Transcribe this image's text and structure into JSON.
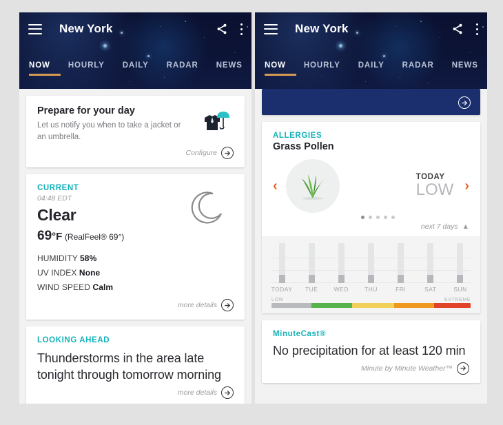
{
  "theme": {
    "accent_teal": "#12b2b8",
    "accent_orange": "#e2622a",
    "tab_indicator": "#d79a52",
    "page_bg": "#e2e2e2",
    "card_bg": "#ffffff",
    "peek_card_bg": "#1b2f6e"
  },
  "header": {
    "city": "New York",
    "menu_icon": "hamburger-icon",
    "share_icon": "share-icon",
    "overflow_icon": "kebab-menu-icon",
    "tabs": [
      {
        "label": "NOW",
        "active": true
      },
      {
        "label": "HOURLY",
        "active": false
      },
      {
        "label": "DAILY",
        "active": false
      },
      {
        "label": "RADAR",
        "active": false
      },
      {
        "label": "NEWS",
        "active": false
      }
    ]
  },
  "left": {
    "prepare": {
      "title": "Prepare for your day",
      "subtitle": "Let us notify you when to take a jacket or an umbrella.",
      "action_label": "Configure",
      "icon": "jacket-umbrella-icon"
    },
    "current": {
      "eyebrow": "CURRENT",
      "time": "04:48 EDT",
      "condition": "Clear",
      "temp": "69",
      "temp_unit": "°F",
      "realfeel": "(RealFeel® 69°)",
      "icon": "crescent-moon-icon",
      "stats": [
        {
          "label": "HUMIDITY",
          "value": "58%"
        },
        {
          "label": "UV INDEX",
          "value": "None"
        },
        {
          "label": "WIND SPEED",
          "value": "Calm"
        }
      ],
      "action_label": "more details"
    },
    "looking_ahead": {
      "eyebrow": "LOOKING AHEAD",
      "text": "Thunderstorms in the area late tonight through tomorrow morning",
      "action_label": "more details"
    }
  },
  "right": {
    "peek_card": {
      "arrow_icon": "arrow-right-circle-icon"
    },
    "allergies": {
      "eyebrow": "ALLERGIES",
      "type": "Grass Pollen",
      "icon": "grass-pollen-icon",
      "prev_icon": "chevron-left-icon",
      "next_icon": "chevron-right-icon",
      "reading_day": "TODAY",
      "reading_value": "LOW",
      "pager_dots": 5,
      "pager_active_index": 0,
      "expand_label": "next 7 days",
      "expand_icon": "chevron-up-icon"
    },
    "minutecast": {
      "eyebrow": "MinuteCast®",
      "text": "No precipitation for at least 120 min",
      "action_label": "Minute by Minute Weather™"
    }
  },
  "chart_data": {
    "type": "bar",
    "title": "Grass Pollen 7-day forecast",
    "categories": [
      "TODAY",
      "TUE",
      "WED",
      "THU",
      "FRI",
      "SAT",
      "SUN"
    ],
    "values": [
      1,
      1,
      1,
      1,
      1,
      1,
      1
    ],
    "ylim": [
      0,
      10
    ],
    "grid": true,
    "xlabel": "",
    "ylabel": "",
    "bar_track_color": "#e4e5e7",
    "bar_fill_color": "#b7b8bb",
    "scale": {
      "min_label": "LOW",
      "max_label": "EXTREME",
      "segments": [
        {
          "name": "low",
          "color": "#b9babd"
        },
        {
          "name": "moderate",
          "color": "#57b24c"
        },
        {
          "name": "high",
          "color": "#f2d15b"
        },
        {
          "name": "very-high",
          "color": "#ef9a1e"
        },
        {
          "name": "extreme",
          "color": "#e0432a"
        }
      ]
    }
  }
}
